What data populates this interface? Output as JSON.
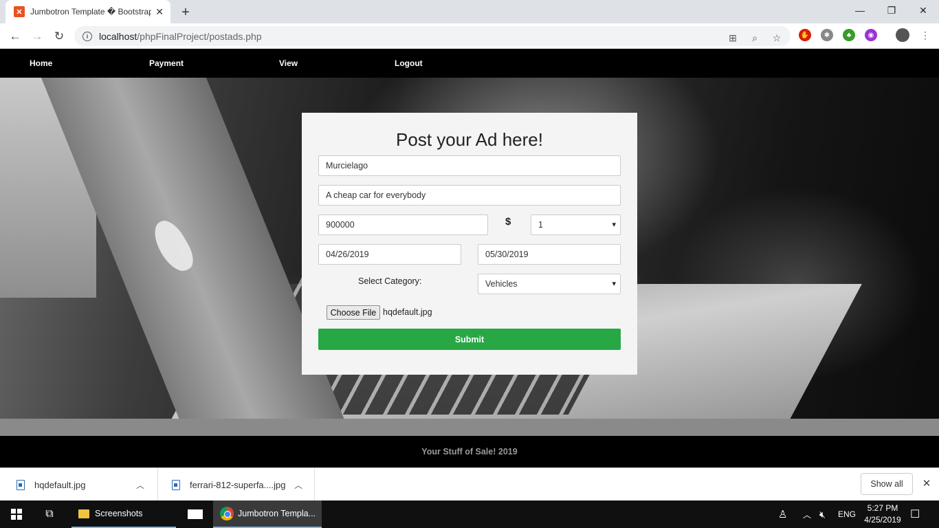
{
  "browser": {
    "tab_title": "Jumbotron Template � Bootstrap",
    "url_host": "localhost",
    "url_path": "/phpFinalProject/postads.php"
  },
  "nav": {
    "items": [
      "Home",
      "Payment",
      "View",
      "Logout"
    ]
  },
  "form": {
    "title": "Post your Ad here!",
    "name_value": "Murcielago",
    "description_value": "A cheap car for everybody",
    "price_value": "900000",
    "currency_symbol": "$",
    "quantity_value": "1",
    "start_date_value": "04/26/2019",
    "end_date_value": "05/30/2019",
    "category_label": "Select Category:",
    "category_value": "Vehicles",
    "choose_file_label": "Choose File",
    "file_name": "hqdefault.jpg",
    "submit_label": "Submit"
  },
  "footer": {
    "text": "Your Stuff of Sale! 2019"
  },
  "downloads": {
    "items": [
      "hqdefault.jpg",
      "ferrari-812-superfa....jpg"
    ],
    "show_all_label": "Show all"
  },
  "taskbar": {
    "folder_label": "Screenshots",
    "chrome_label": "Jumbotron Templa...",
    "language": "ENG",
    "time": "5:27 PM",
    "date": "4/25/2019"
  },
  "colors": {
    "submit_green": "#28a745",
    "nav_black": "#000000",
    "card_bg": "#f4f4f4"
  }
}
